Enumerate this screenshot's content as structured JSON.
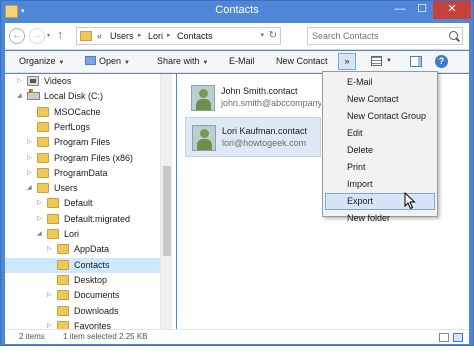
{
  "window": {
    "title": "Contacts",
    "controls": {
      "minimize": "—",
      "maximize": "☐",
      "close": "✕"
    }
  },
  "address_bar": {
    "prefix": "«",
    "crumbs": [
      "Users",
      "Lori",
      "Contacts"
    ],
    "search_placeholder": "Search Contacts"
  },
  "toolbar": {
    "organize": "Organize",
    "open": "Open",
    "share_with": "Share with",
    "email": "E-Mail",
    "new_contact": "New Contact",
    "more": "»"
  },
  "nav_tree": [
    {
      "label": "Videos",
      "icon": "video-folder-icon",
      "expander": "▷"
    },
    {
      "label": "Local Disk (C:)",
      "icon": "drive-icon",
      "expander": "◢"
    },
    {
      "label": "MSOCache",
      "icon": "folder-icon",
      "expander": ""
    },
    {
      "label": "PerfLogs",
      "icon": "folder-icon",
      "expander": ""
    },
    {
      "label": "Program Files",
      "icon": "folder-icon",
      "expander": "▷"
    },
    {
      "label": "Program Files (x86)",
      "icon": "folder-icon",
      "expander": "▷"
    },
    {
      "label": "ProgramData",
      "icon": "folder-icon",
      "expander": "▷"
    },
    {
      "label": "Users",
      "icon": "folder-icon",
      "expander": "◢"
    },
    {
      "label": "Default",
      "icon": "folder-icon",
      "expander": "▷"
    },
    {
      "label": "Default.migrated",
      "icon": "folder-icon",
      "expander": "▷"
    },
    {
      "label": "Lori",
      "icon": "folder-icon",
      "expander": "◢"
    },
    {
      "label": "AppData",
      "icon": "folder-icon",
      "expander": "▷"
    },
    {
      "label": "Contacts",
      "icon": "folder-icon",
      "expander": ""
    },
    {
      "label": "Desktop",
      "icon": "folder-icon",
      "expander": ""
    },
    {
      "label": "Documents",
      "icon": "folder-icon",
      "expander": "▷"
    },
    {
      "label": "Downloads",
      "icon": "folder-icon",
      "expander": ""
    },
    {
      "label": "Favorites",
      "icon": "folder-icon",
      "expander": "▷"
    }
  ],
  "contacts": [
    {
      "name": "John Smith.contact",
      "email": "john.smith@abccompany.com"
    },
    {
      "name": "Lori Kaufman.contact",
      "email": "lori@howtogeek.com"
    }
  ],
  "menu": {
    "items": [
      "E-Mail",
      "New Contact",
      "New Contact Group",
      "Edit",
      "Delete",
      "Print",
      "Import",
      "Export",
      "New folder"
    ],
    "hovered": "Export"
  },
  "status": {
    "count": "2 items",
    "selection": "1 item selected  2.25 KB"
  },
  "colors": {
    "titlebar": "#4f86d8",
    "selection": "#cde8ff",
    "menu_hover": "#d5e5f7"
  }
}
